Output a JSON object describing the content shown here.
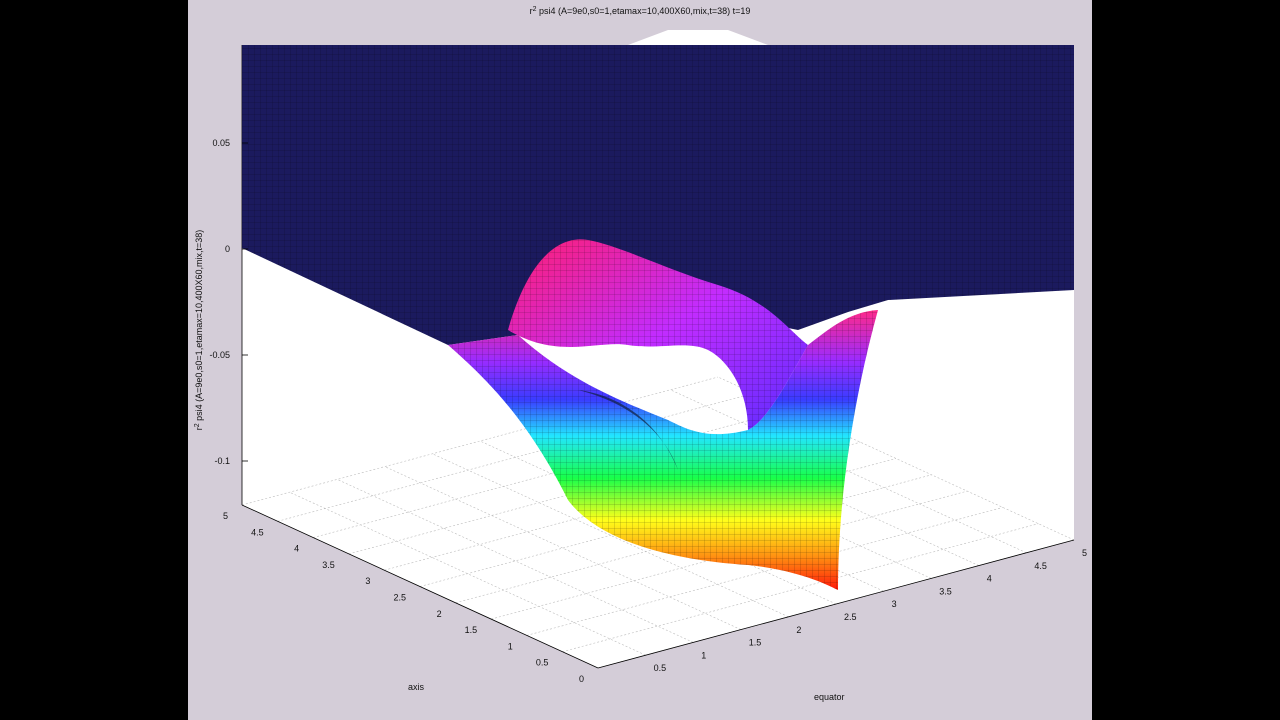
{
  "chart_data": {
    "type": "surface",
    "title": "r² psi4 (A=9e0,s0=1,etamax=10,400X60,mix,t=38) t=19",
    "title_base": "r",
    "title_sup": "2",
    "title_rest": " psi4 (A=9e0,s0=1,etamax=10,400X60,mix,t=38) t=19",
    "zlabel": "r² psi4 (A=9e0,s0=1,etamax=10,400X60,mix,t=38)",
    "zlabel_base": "r",
    "zlabel_sup": "2",
    "zlabel_rest": " psi4 (A=9e0,s0=1,etamax=10,400X60,mix,t=38)",
    "xlabel": "axis",
    "ylabel": "equator",
    "x_ticks": [
      "0",
      "0.5",
      "1",
      "1.5",
      "2",
      "2.5",
      "3",
      "3.5",
      "4",
      "4.5",
      "5"
    ],
    "y_ticks": [
      "0.5",
      "1",
      "1.5",
      "2",
      "2.5",
      "3",
      "3.5",
      "4",
      "4.5",
      "5"
    ],
    "z_ticks": [
      "0.05",
      "0",
      "-0.05",
      "-0.1"
    ],
    "xlim": [
      0,
      5
    ],
    "ylim": [
      0,
      5
    ],
    "zlim": [
      -0.12,
      0.08
    ],
    "grid": true,
    "colormap": "hsv"
  }
}
